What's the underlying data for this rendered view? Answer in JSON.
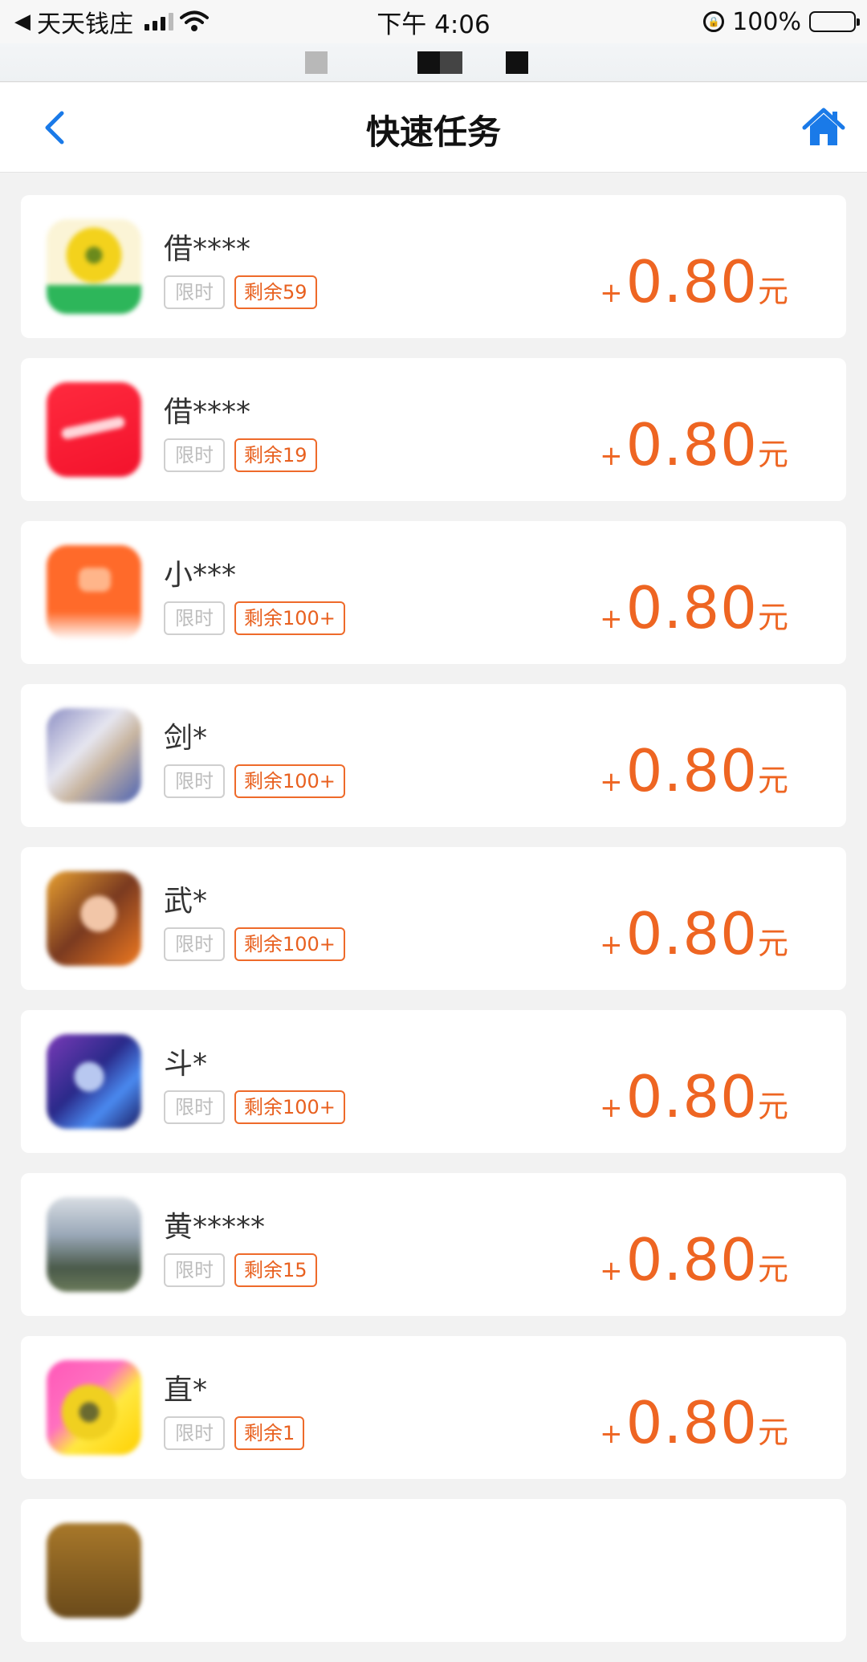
{
  "status_bar": {
    "back_app": "天天钱庄",
    "time": "下午 4:06",
    "battery": "100%"
  },
  "nav": {
    "title": "快速任务"
  },
  "colors": {
    "accent_blue": "#1a7ae8",
    "reward_orange": "#ee6522",
    "tag_orange": "#e8601f"
  },
  "tasks": [
    {
      "name": "借****",
      "tag_limit": "限时",
      "remaining": "剩余59",
      "plus": "+",
      "amount": "0.80",
      "unit": "元",
      "icon": "sunflower-app-icon"
    },
    {
      "name": "借****",
      "tag_limit": "限时",
      "remaining": "剩余19",
      "plus": "+",
      "amount": "0.80",
      "unit": "元",
      "icon": "red-app-icon"
    },
    {
      "name": "小***",
      "tag_limit": "限时",
      "remaining": "剩余100+",
      "plus": "+",
      "amount": "0.80",
      "unit": "元",
      "icon": "orange-app-icon"
    },
    {
      "name": "剑*",
      "tag_limit": "限时",
      "remaining": "剩余100+",
      "plus": "+",
      "amount": "0.80",
      "unit": "元",
      "icon": "game-app-icon"
    },
    {
      "name": "武*",
      "tag_limit": "限时",
      "remaining": "剩余100+",
      "plus": "+",
      "amount": "0.80",
      "unit": "元",
      "icon": "game-app-icon"
    },
    {
      "name": "斗*",
      "tag_limit": "限时",
      "remaining": "剩余100+",
      "plus": "+",
      "amount": "0.80",
      "unit": "元",
      "icon": "game-app-icon"
    },
    {
      "name": "黄*****",
      "tag_limit": "限时",
      "remaining": "剩余15",
      "plus": "+",
      "amount": "0.80",
      "unit": "元",
      "icon": "game-app-icon"
    },
    {
      "name": "直*",
      "tag_limit": "限时",
      "remaining": "剩余1",
      "plus": "+",
      "amount": "0.80",
      "unit": "元",
      "icon": "sunflower-app-icon"
    }
  ]
}
